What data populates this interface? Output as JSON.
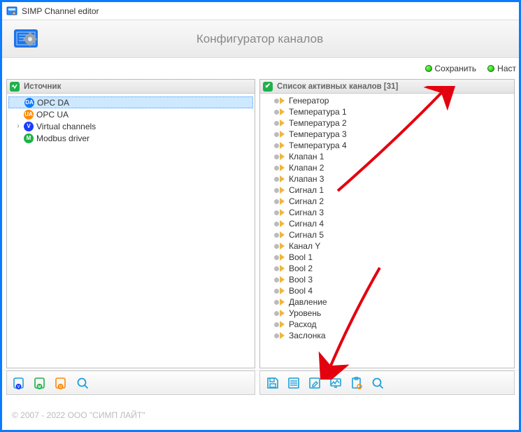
{
  "window": {
    "title": "SIMP Channel editor"
  },
  "banner": {
    "title": "Конфигуратор каналов"
  },
  "actions": {
    "save": "Сохранить",
    "settings": "Наст"
  },
  "left": {
    "header": "Источник",
    "items": [
      {
        "label": "OPC DA",
        "badge": "DA",
        "cls": "da",
        "caret": "",
        "selected": true
      },
      {
        "label": "OPC UA",
        "badge": "UA",
        "cls": "ua",
        "caret": ""
      },
      {
        "label": "Virtual channels",
        "badge": "V",
        "cls": "v",
        "caret": "›"
      },
      {
        "label": "Modbus driver",
        "badge": "M",
        "cls": "m",
        "caret": ""
      }
    ]
  },
  "right": {
    "header": "Список активных каналов [31]",
    "items": [
      "Генератор",
      "Температура 1",
      "Температура 2",
      "Температура 3",
      "Температура 4",
      "Клапан 1",
      "Клапан 2",
      "Клапан 3",
      "Сигнал 1",
      "Сигнал 2",
      "Сигнал 3",
      "Сигнал 4",
      "Сигнал 5",
      "Канал Y",
      "Bool 1",
      "Bool 2",
      "Bool 3",
      "Bool 4",
      "Давление",
      "Уровень",
      "Расход",
      "Заслонка"
    ]
  },
  "footer": {
    "copyright": "© 2007 - 2022  ООО \"СИМП ЛАЙТ\""
  }
}
